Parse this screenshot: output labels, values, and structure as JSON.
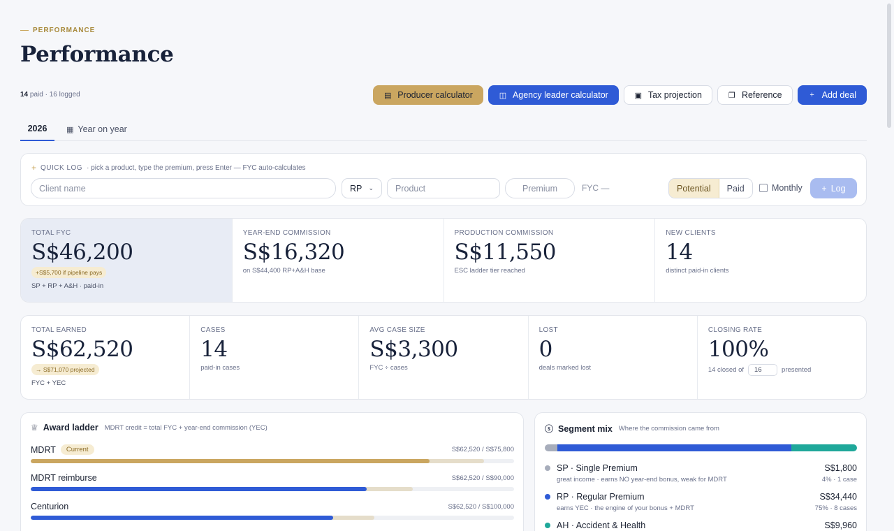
{
  "header": {
    "eyebrow": "PERFORMANCE",
    "title": "Performance",
    "paid_count": "14",
    "paid_suffix": "paid · 16 logged"
  },
  "actions": {
    "producer_calculator": "Producer calculator",
    "agency_leader_calculator": "Agency leader calculator",
    "tax_projection": "Tax projection",
    "reference": "Reference",
    "add_deal": "Add deal"
  },
  "tabs": {
    "current": "2026",
    "yoy": "Year on year"
  },
  "quick_log": {
    "label": "QUICK LOG",
    "hint": "· pick a product, type the premium, press Enter — FYC auto-calculates",
    "client_placeholder": "Client name",
    "type_value": "RP",
    "product_placeholder": "Product",
    "premium_placeholder": "Premium",
    "fyc": "FYC —",
    "toggle_potential": "Potential",
    "toggle_paid": "Paid",
    "monthly": "Monthly",
    "log_button": "Log"
  },
  "stats_row1": [
    {
      "label": "TOTAL FYC",
      "value": "S$46,200",
      "pill": "+S$5,700 if pipeline pays",
      "sub": "SP + RP + A&H · paid-in"
    },
    {
      "label": "YEAR-END COMMISSION",
      "value": "S$16,320",
      "sub": "on S$44,400 RP+A&H base"
    },
    {
      "label": "PRODUCTION COMMISSION",
      "value": "S$11,550",
      "sub": "ESC ladder tier reached"
    },
    {
      "label": "NEW CLIENTS",
      "value": "14",
      "sub": "distinct paid-in clients"
    }
  ],
  "stats_row2": [
    {
      "label": "TOTAL EARNED",
      "value": "S$62,520",
      "pill": "→ S$71,070 projected",
      "sub": "FYC + YEC"
    },
    {
      "label": "CASES",
      "value": "14",
      "sub": "paid-in cases"
    },
    {
      "label": "AVG CASE SIZE",
      "value": "S$3,300",
      "sub": "FYC ÷ cases"
    },
    {
      "label": "LOST",
      "value": "0",
      "sub": "deals marked lost"
    },
    {
      "label": "CLOSING RATE",
      "value": "100%",
      "closed_prefix": "14 closed of",
      "presented_value": "16",
      "closed_suffix": "presented"
    }
  ],
  "award_ladder": {
    "title": "Award ladder",
    "subtitle": "MDRT credit = total FYC + year-end commission (YEC)",
    "current_badge": "Current",
    "rows": [
      {
        "name": "MDRT",
        "amount": "S$62,520 / S$75,800",
        "progress": 0.825,
        "projected": 0.938,
        "color": "gold",
        "current": true
      },
      {
        "name": "MDRT reimburse",
        "amount": "S$62,520 / S$90,000",
        "progress": 0.695,
        "projected": 0.79,
        "color": "blue",
        "current": false
      },
      {
        "name": "Centurion",
        "amount": "S$62,520 / S$100,000",
        "progress": 0.625,
        "projected": 0.711,
        "color": "blue",
        "current": false
      }
    ]
  },
  "segment_mix": {
    "title": "Segment mix",
    "subtitle": "Where the commission came from",
    "bar": [
      {
        "share": 4,
        "color": "#a7adbb"
      },
      {
        "share": 75,
        "color": "#2f5bd6"
      },
      {
        "share": 21,
        "color": "#1fa89a"
      }
    ],
    "rows": [
      {
        "name": "SP · Single Premium",
        "amount": "S$1,800",
        "desc": "great income · earns NO year-end bonus, weak for MDRT",
        "meta": "4% · 1 case",
        "color": "#a7adbb"
      },
      {
        "name": "RP · Regular Premium",
        "amount": "S$34,440",
        "desc": "earns YEC · the engine of your bonus + MDRT",
        "meta": "75% · 8 cases",
        "color": "#2f5bd6"
      },
      {
        "name": "AH · Accident & Health",
        "amount": "S$9,960",
        "desc": "",
        "meta": "",
        "color": "#1fa89a"
      }
    ]
  }
}
